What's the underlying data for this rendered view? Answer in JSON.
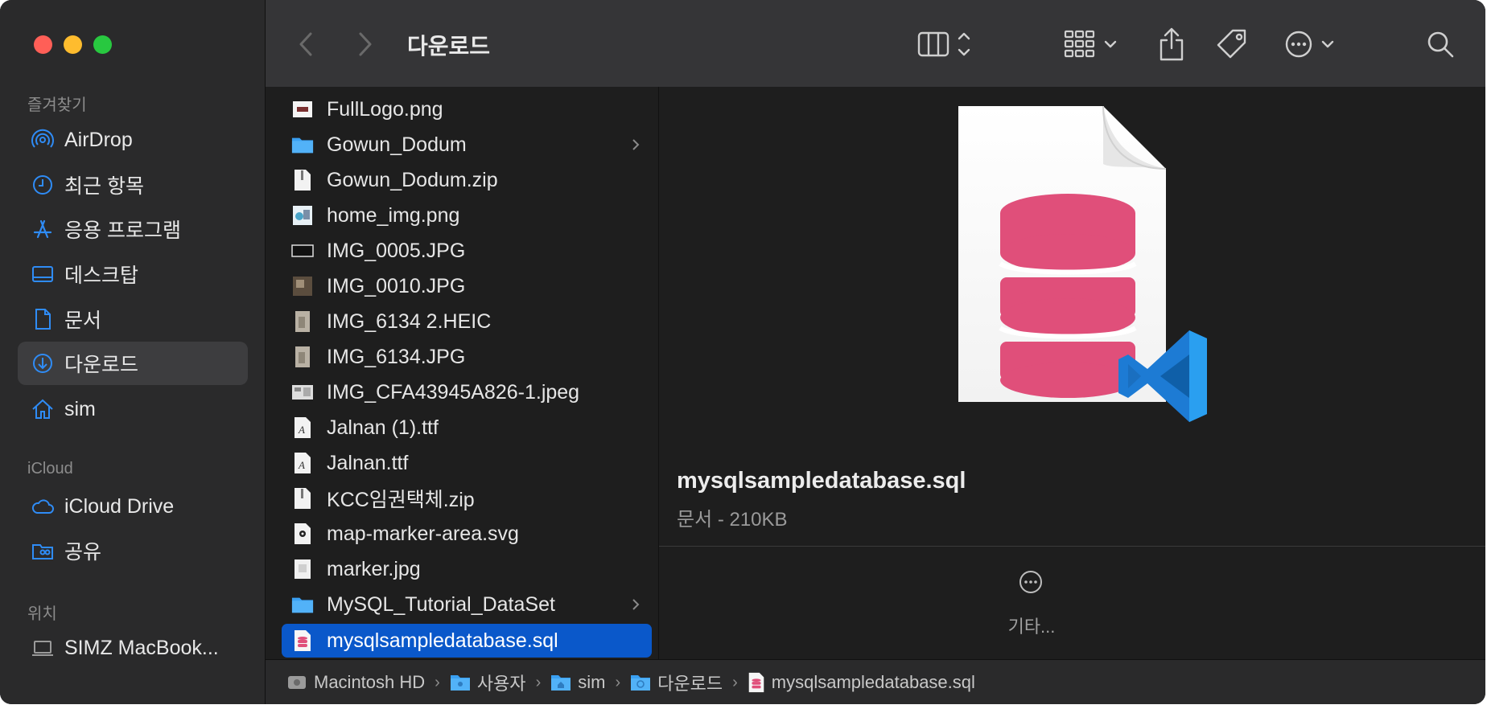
{
  "window": {
    "title": "다운로드"
  },
  "sidebar": {
    "favorites_header": "즐겨찾기",
    "favorites": [
      {
        "label": "AirDrop",
        "icon": "airdrop-icon"
      },
      {
        "label": "최근 항목",
        "icon": "clock-icon"
      },
      {
        "label": "응용 프로그램",
        "icon": "applications-icon"
      },
      {
        "label": "데스크탑",
        "icon": "desktop-icon"
      },
      {
        "label": "문서",
        "icon": "document-icon"
      },
      {
        "label": "다운로드",
        "icon": "download-icon",
        "selected": true
      },
      {
        "label": "sim",
        "icon": "home-icon"
      }
    ],
    "icloud_header": "iCloud",
    "icloud": [
      {
        "label": "iCloud Drive",
        "icon": "cloud-icon"
      },
      {
        "label": "공유",
        "icon": "shared-folder-icon"
      }
    ],
    "locations_header": "위치",
    "locations": [
      {
        "label": "SIMZ MacBook...",
        "icon": "laptop-icon"
      }
    ]
  },
  "files": [
    {
      "name": "FullLogo.png",
      "kind": "image"
    },
    {
      "name": "Gowun_Dodum",
      "kind": "folder",
      "has_children": true
    },
    {
      "name": "Gowun_Dodum.zip",
      "kind": "zip"
    },
    {
      "name": "home_img.png",
      "kind": "image"
    },
    {
      "name": "IMG_0005.JPG",
      "kind": "image"
    },
    {
      "name": "IMG_0010.JPG",
      "kind": "image"
    },
    {
      "name": "IMG_6134 2.HEIC",
      "kind": "image"
    },
    {
      "name": "IMG_6134.JPG",
      "kind": "image"
    },
    {
      "name": "IMG_CFA43945A826-1.jpeg",
      "kind": "image"
    },
    {
      "name": "Jalnan (1).ttf",
      "kind": "font"
    },
    {
      "name": "Jalnan.ttf",
      "kind": "font"
    },
    {
      "name": "KCC임권택체.zip",
      "kind": "zip"
    },
    {
      "name": "map-marker-area.svg",
      "kind": "svg"
    },
    {
      "name": "marker.jpg",
      "kind": "image"
    },
    {
      "name": "MySQL_Tutorial_DataSet",
      "kind": "folder",
      "has_children": true
    },
    {
      "name": "mysqlsampledatabase.sql",
      "kind": "sql",
      "selected": true
    }
  ],
  "preview": {
    "filename": "mysqlsampledatabase.sql",
    "meta": "문서 - 210KB",
    "more_label": "기타..."
  },
  "pathbar": [
    {
      "label": "Macintosh HD",
      "icon": "disk-icon"
    },
    {
      "label": "사용자",
      "icon": "folder-icon"
    },
    {
      "label": "sim",
      "icon": "home-folder-icon"
    },
    {
      "label": "다운로드",
      "icon": "download-folder-icon"
    },
    {
      "label": "mysqlsampledatabase.sql",
      "icon": "sql-file-icon"
    }
  ],
  "colors": {
    "selection": "#0a58ca",
    "accent_icon": "#2f8cf6",
    "sql_db": "#e04f7a",
    "vscode": "#2a9ff0"
  }
}
